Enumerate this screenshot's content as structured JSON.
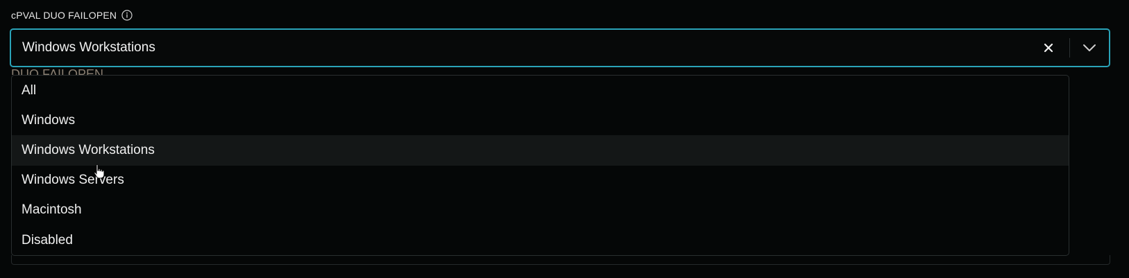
{
  "field": {
    "label": "cPVAL DUO FAILOPEN",
    "info_icon": "info-icon",
    "selected_value": "Windows Workstations",
    "clear_icon": "close-icon",
    "toggle_icon": "chevron-down-icon",
    "behind_label": "DUO FAILOPEN"
  },
  "menu": {
    "options": [
      {
        "label": "All"
      },
      {
        "label": "Windows"
      },
      {
        "label": "Windows Workstations",
        "hovered": true
      },
      {
        "label": "Windows Servers"
      },
      {
        "label": "Macintosh"
      },
      {
        "label": "Disabled"
      }
    ]
  },
  "colors": {
    "background": "#050707",
    "focus_border": "#2aa3b8",
    "hover_bg": "#141717",
    "text": "#f0f0f0"
  }
}
